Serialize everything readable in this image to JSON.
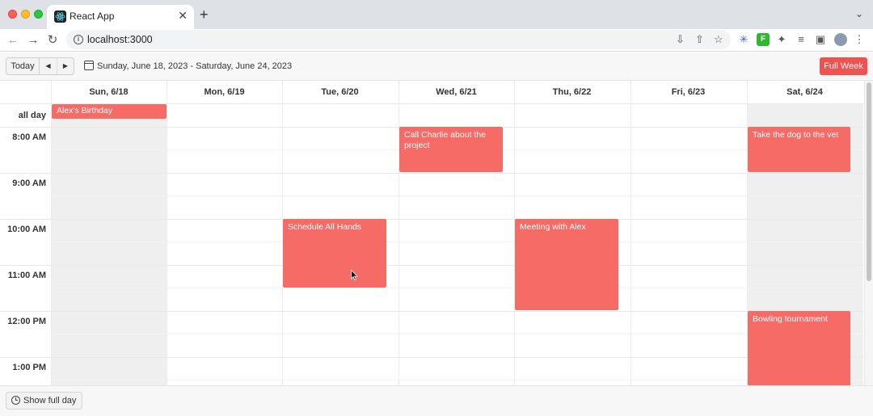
{
  "browser": {
    "tab_title": "React App",
    "tab_close": "✕",
    "new_tab": "+",
    "url": "localhost:3000"
  },
  "header": {
    "today_label": "Today",
    "prev_label": "◀",
    "next_label": "▶",
    "date_range": "Sunday, June 18, 2023 - Saturday, June 24, 2023",
    "full_week_label": "Full Week"
  },
  "days": [
    "Sun, 6/18",
    "Mon, 6/19",
    "Tue, 6/20",
    "Wed, 6/21",
    "Thu, 6/22",
    "Fri, 6/23",
    "Sat, 6/24"
  ],
  "allday_label": "all day",
  "times": [
    "8:00 AM",
    "9:00 AM",
    "10:00 AM",
    "11:00 AM",
    "12:00 PM",
    "1:00 PM"
  ],
  "events": {
    "birthday": "Alex's Birthday",
    "call_charlie": "Call Charlie about the project",
    "dog_vet": "Take the dog to the vet",
    "all_hands": "Schedule All Hands",
    "meeting_alex": "Meeting with Alex",
    "bowling": "Bowling tournament"
  },
  "footer": {
    "show_full_day_label": "Show full day"
  },
  "colors": {
    "event": "#f66b66",
    "accent": "#f0524f"
  }
}
